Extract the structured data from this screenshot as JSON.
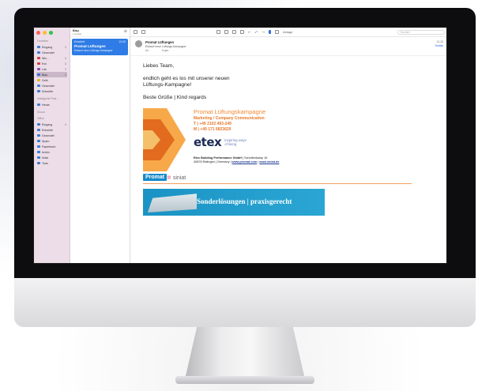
{
  "window": {
    "traffic_colors": [
      "#ff5f57",
      "#febc2e",
      "#28c840"
    ]
  },
  "sidebar": {
    "section_favorites": "Favoriten",
    "favorites": [
      {
        "label": "Eingang",
        "count": "5",
        "color": "#3a7bd5",
        "selected": false
      },
      {
        "label": "Gesendet",
        "count": "",
        "color": "#3a7bd5",
        "selected": false
      },
      {
        "label": "Wic...",
        "count": "8",
        "color": "#d23c3c",
        "selected": false
      },
      {
        "label": "Rot",
        "count": "8",
        "color": "#d23c3c",
        "selected": false
      },
      {
        "label": "Lila",
        "count": "9",
        "color": "#8b4bb8",
        "selected": false
      },
      {
        "label": "Blau",
        "count": "8",
        "color": "#2f6fe0",
        "selected": true
      },
      {
        "label": "Gelb",
        "count": "",
        "color": "#e0b430",
        "selected": false
      },
      {
        "label": "Gesendet",
        "count": "",
        "color": "#3a7bd5",
        "selected": false
      },
      {
        "label": "Entwürfe",
        "count": "",
        "color": "#3a7bd5",
        "selected": false
      }
    ],
    "section_smart": "Intelligente Post...",
    "smart": [
      {
        "label": "Heute",
        "count": "",
        "color": "#3a7bd5",
        "selected": false
      }
    ],
    "section_icloud": "iCloud",
    "section_office": "Office",
    "office": [
      {
        "label": "Eingang",
        "count": "5",
        "color": "#3a7bd5",
        "selected": false
      },
      {
        "label": "Entwürfe",
        "count": "",
        "color": "#3a7bd5",
        "selected": false
      },
      {
        "label": "Gesendet",
        "count": "",
        "color": "#3a7bd5",
        "selected": false
      },
      {
        "label": "Spam",
        "count": "",
        "color": "#3a7bd5",
        "selected": false
      },
      {
        "label": "Papierkorb",
        "count": "",
        "color": "#3a7bd5",
        "selected": false
      },
      {
        "label": "Archiv",
        "count": "",
        "color": "#3a7bd5",
        "selected": false
      },
      {
        "label": "Notiz",
        "count": "",
        "color": "#3a7bd5",
        "selected": false
      },
      {
        "label": "Todo",
        "count": "",
        "color": "#3a7bd5",
        "selected": false
      }
    ]
  },
  "list": {
    "title": "Blau",
    "subtitle": "1 E-Mail",
    "item": {
      "from": "Entwürfe",
      "time": "10:25",
      "subject": "Promat Lüftungen",
      "preview": "Entwurf neue Lüftungs-Kampagne"
    }
  },
  "toolbar": {
    "folder": "Ablage",
    "search_placeholder": "Suchen"
  },
  "message": {
    "sender": "Promat Lüftungen",
    "subject_line": "Entwurf neue Lüftungs-Kampagne",
    "to_label": "An:",
    "cc_label": "Kopie:",
    "time": "10:25",
    "details_link": "Details",
    "body": {
      "greeting": "Liebes Team,",
      "line1": "endlich geht es los mit unserer neuen",
      "line2": "Lüftungs-Kampagne!",
      "closing": "Beste Grüße | Kind regards"
    },
    "signature": {
      "name": "Promat Lüftungskampagne",
      "role": "Marketing / Company Communication",
      "phone": "T | +49 2102 493-249",
      "mobile": "M | +49 171 6823629",
      "brand": "etex",
      "tagline": "inspiring ways of living",
      "company_bold": "Etex Building Performance GmbH",
      "address_rest": " | Scheifenkamp 16",
      "address2": "40878 Ratingen | Germany |",
      "web1": "www.promat.com",
      "web2": "www.siniat.de",
      "logo_promat": "Promat",
      "logo_siniat": "siniat",
      "banner_text": "Sonderlösungen | praxisgerecht",
      "orange_light": "#f7a94a",
      "orange_dark": "#e26b1f"
    }
  }
}
